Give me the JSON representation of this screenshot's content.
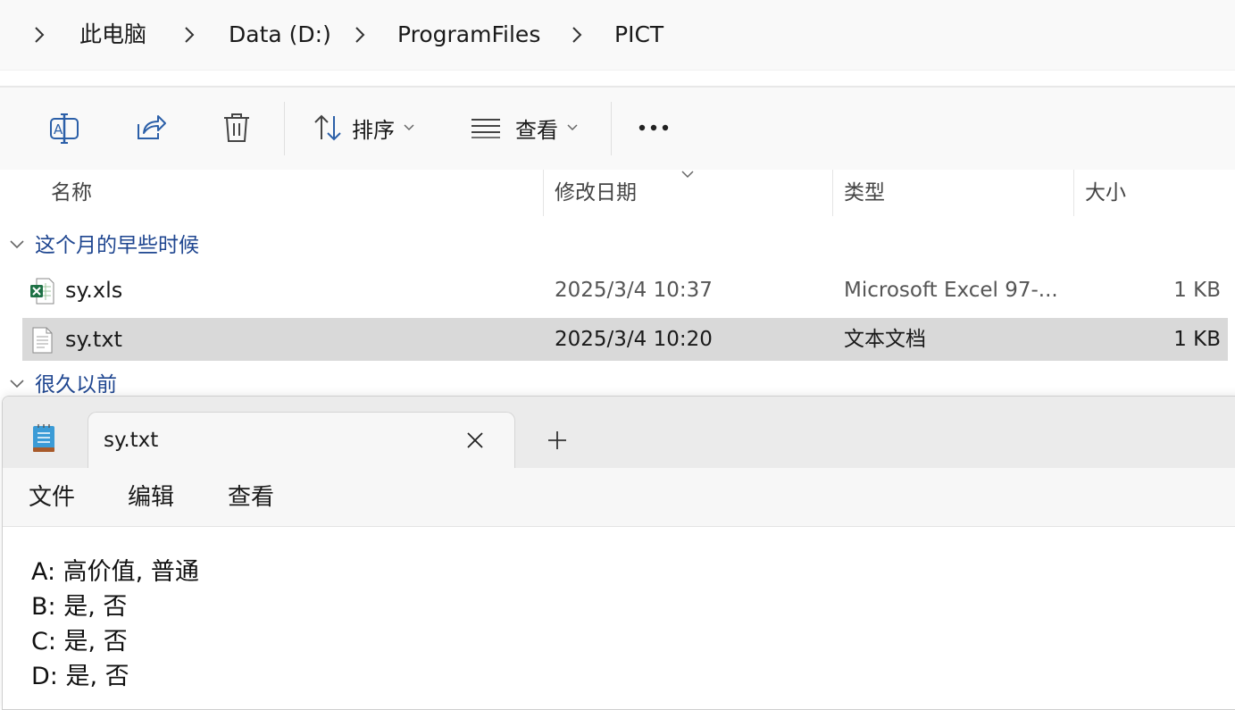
{
  "breadcrumb": {
    "items": [
      "此电脑",
      "Data (D:)",
      "ProgramFiles",
      "PICT"
    ]
  },
  "toolbar": {
    "sort_label": "排序",
    "view_label": "查看",
    "more_icon": "more-icon"
  },
  "columns": {
    "name": "名称",
    "date": "修改日期",
    "type": "类型",
    "size": "大小"
  },
  "groups": {
    "recent": "这个月的早些时候",
    "older": "很久以前"
  },
  "files": [
    {
      "name": "sy.xls",
      "date": "2025/3/4 10:37",
      "type": "Microsoft Excel 97-...",
      "size": "1 KB",
      "icon": "excel-file-icon",
      "selected": false
    },
    {
      "name": "sy.txt",
      "date": "2025/3/4 10:20",
      "type": "文本文档",
      "size": "1 KB",
      "icon": "text-file-icon",
      "selected": true
    }
  ],
  "notepad": {
    "tab_title": "sy.txt",
    "menu": [
      "文件",
      "编辑",
      "查看"
    ],
    "lines": [
      "A: 高价值, 普通",
      "B: 是, 否",
      "C: 是, 否",
      "D: 是, 否"
    ]
  },
  "colors": {
    "group_header": "#1f4690",
    "selected_row": "#d9d9d9",
    "toolbar_icon": "#2b5fa8"
  }
}
